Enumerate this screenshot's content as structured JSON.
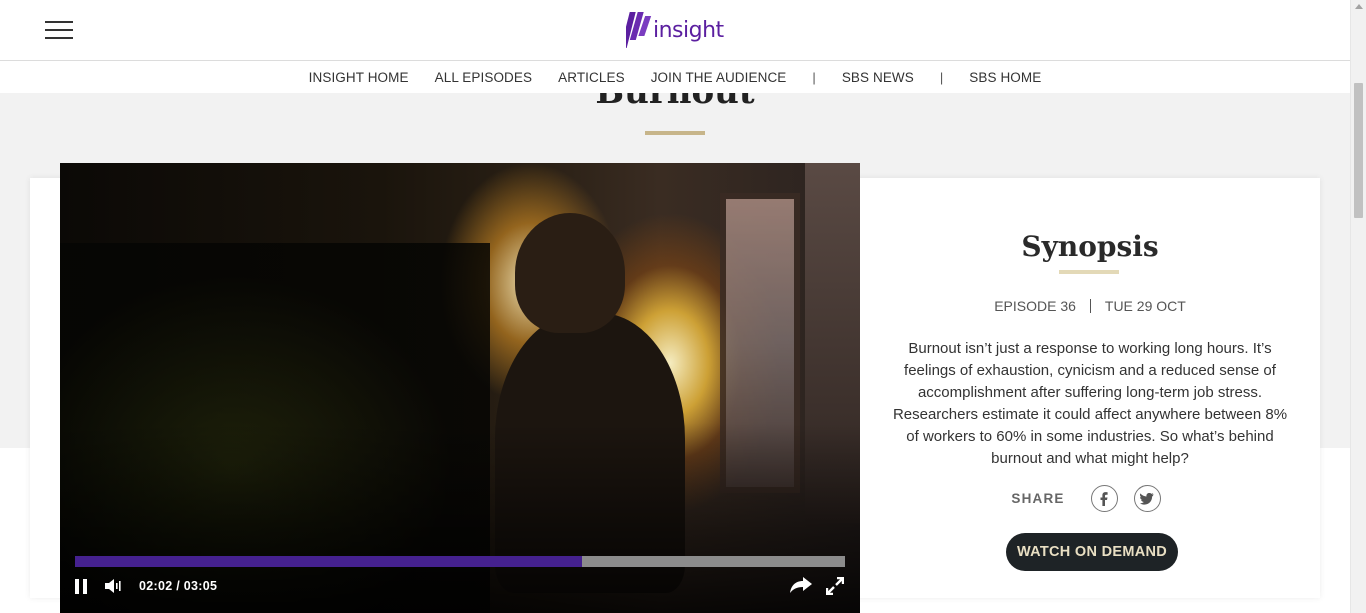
{
  "header": {
    "logo_text": "insight",
    "menu_icon": "hamburger-menu-icon"
  },
  "nav": {
    "items": [
      {
        "label": "INSIGHT HOME"
      },
      {
        "label": "ALL EPISODES"
      },
      {
        "label": "ARTICLES"
      },
      {
        "label": "JOIN THE AUDIENCE"
      },
      {
        "label": "SBS NEWS"
      },
      {
        "label": "SBS HOME"
      }
    ],
    "separator": "|"
  },
  "page": {
    "title": "Burnout"
  },
  "video": {
    "current_time": "02:02",
    "duration": "03:05",
    "time_display": "02:02 / 03:05",
    "progress_fraction": 0.659,
    "progress_color": "#45218f",
    "icons": {
      "pause": "pause-icon",
      "volume": "volume-icon",
      "share": "share-arrow-icon",
      "fullscreen": "fullscreen-icon"
    }
  },
  "synopsis": {
    "title": "Synopsis",
    "episode": "EPISODE 36",
    "date": "TUE 29 OCT",
    "description": "Burnout isn’t just a response to working long hours. It’s feelings of exhaustion, cynicism and a reduced sense of accomplishment after suffering long-term job stress. Researchers estimate it could affect anywhere between 8% of workers to 60% in some industries. So what’s behind burnout and what might help?",
    "share_label": "SHARE",
    "share_icons": [
      "facebook-icon",
      "twitter-icon"
    ],
    "watch_button": "WATCH ON DEMAND"
  },
  "colors": {
    "brand_purple": "#5b1fa0",
    "accent_gold": "#c7b58a",
    "button_dark": "#1e2326"
  }
}
